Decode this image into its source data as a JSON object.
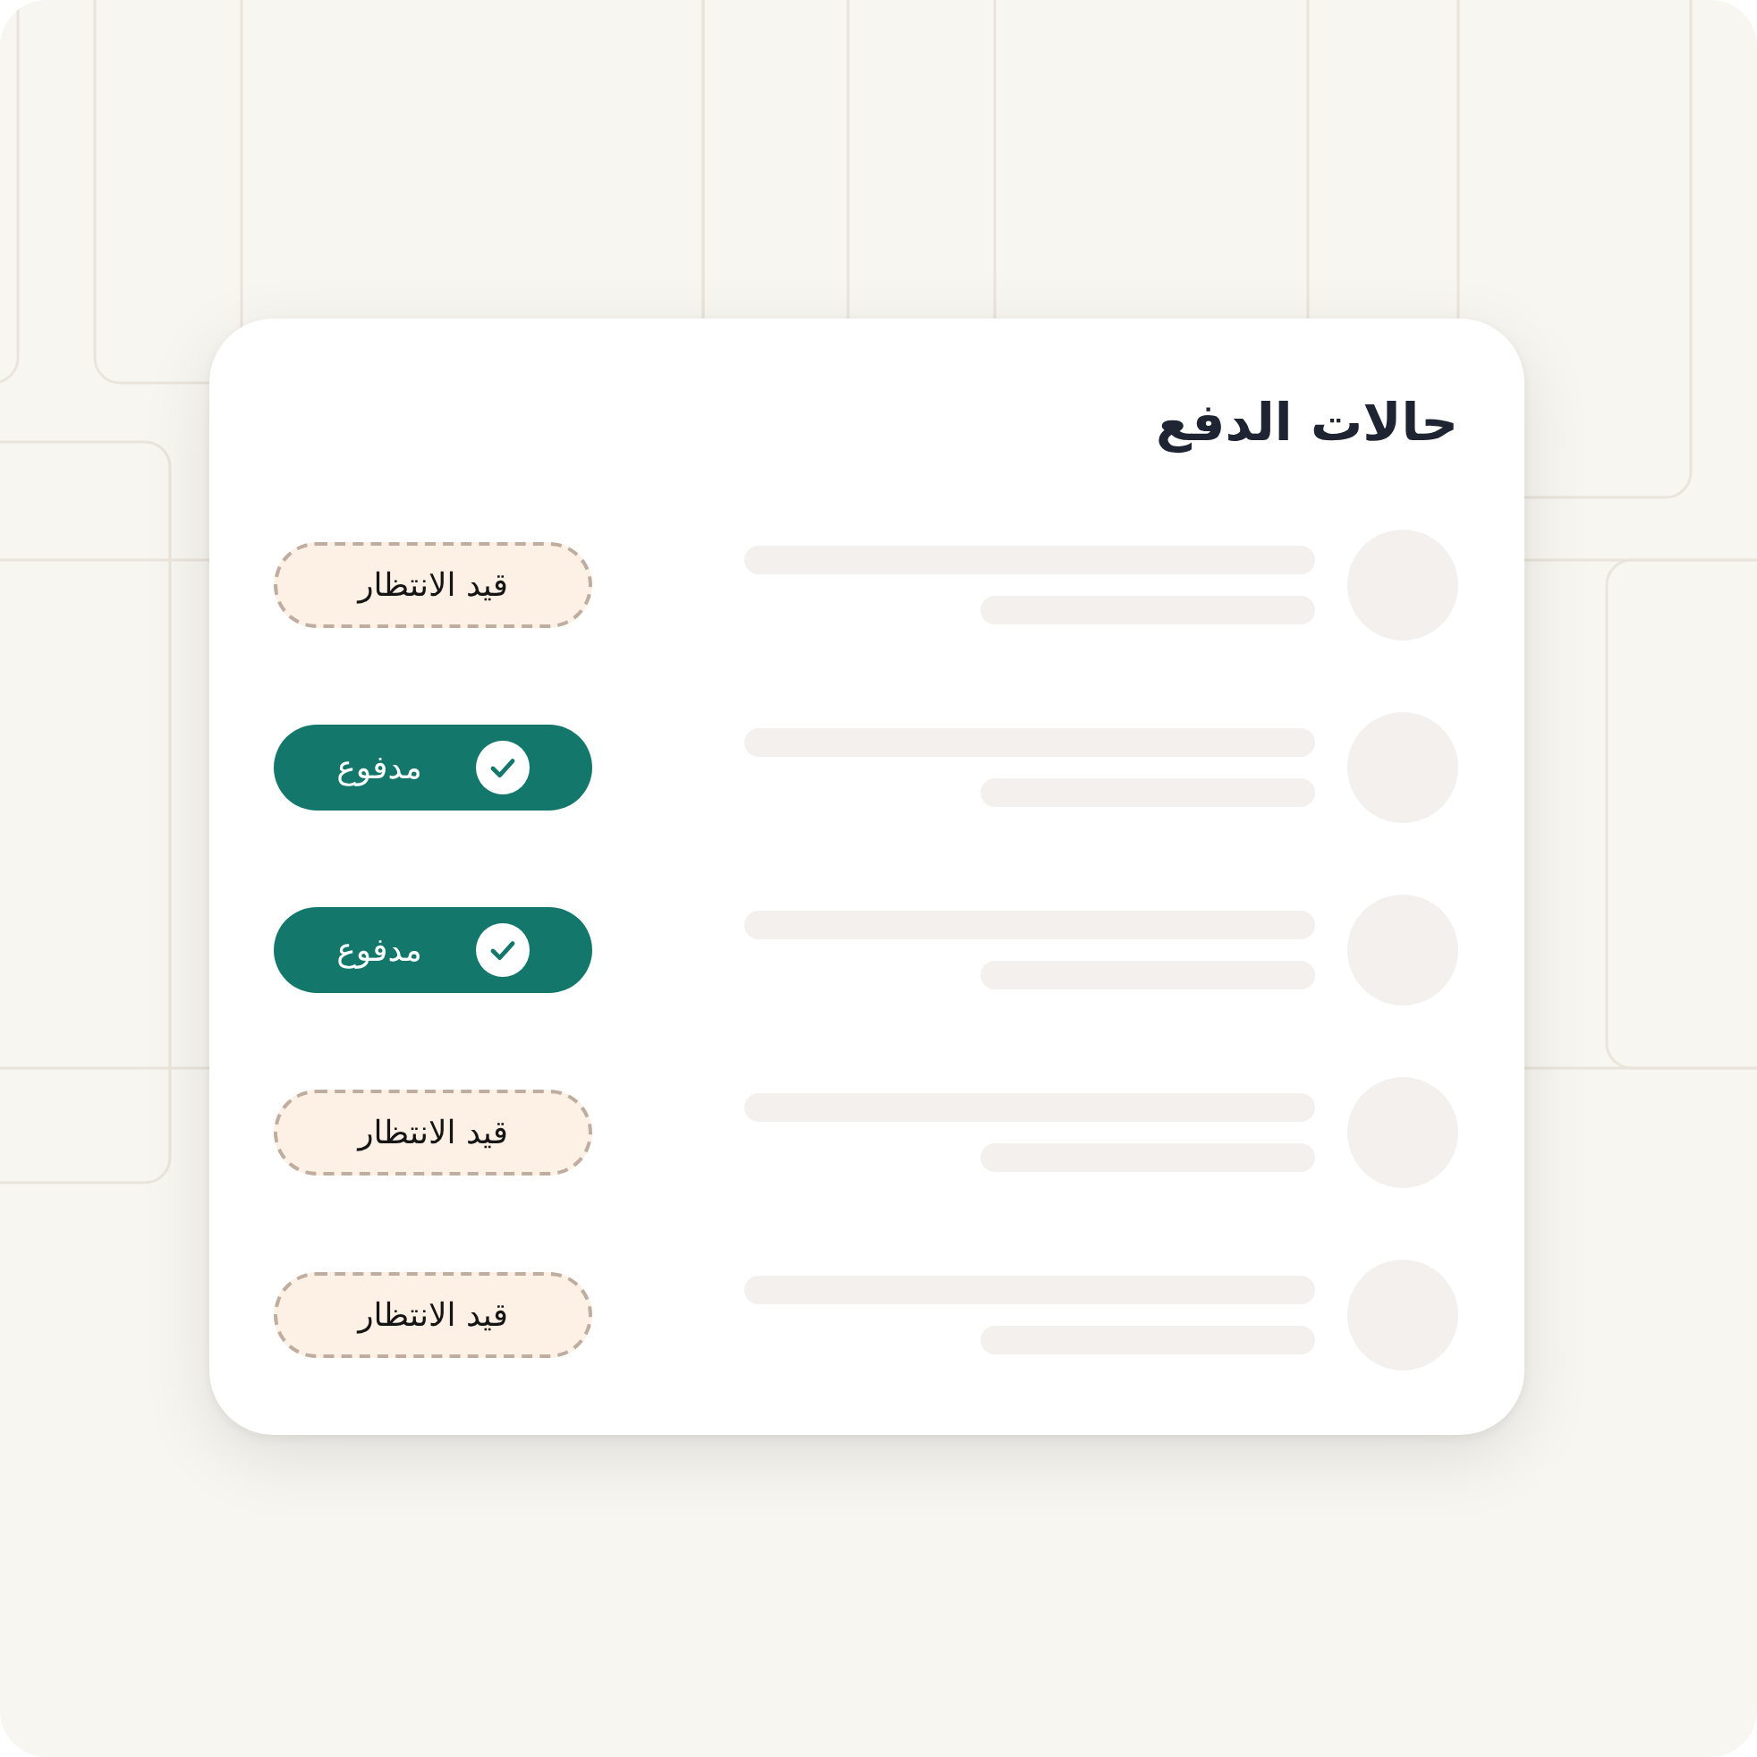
{
  "card": {
    "title": "حالات الدفع",
    "rows": [
      {
        "status": {
          "kind": "pending",
          "label": "قيد الانتظار"
        }
      },
      {
        "status": {
          "kind": "paid",
          "label": "مدفوع"
        }
      },
      {
        "status": {
          "kind": "paid",
          "label": "مدفوع"
        }
      },
      {
        "status": {
          "kind": "pending",
          "label": "قيد الانتظار"
        }
      },
      {
        "status": {
          "kind": "pending",
          "label": "قيد الانتظار"
        }
      }
    ]
  }
}
